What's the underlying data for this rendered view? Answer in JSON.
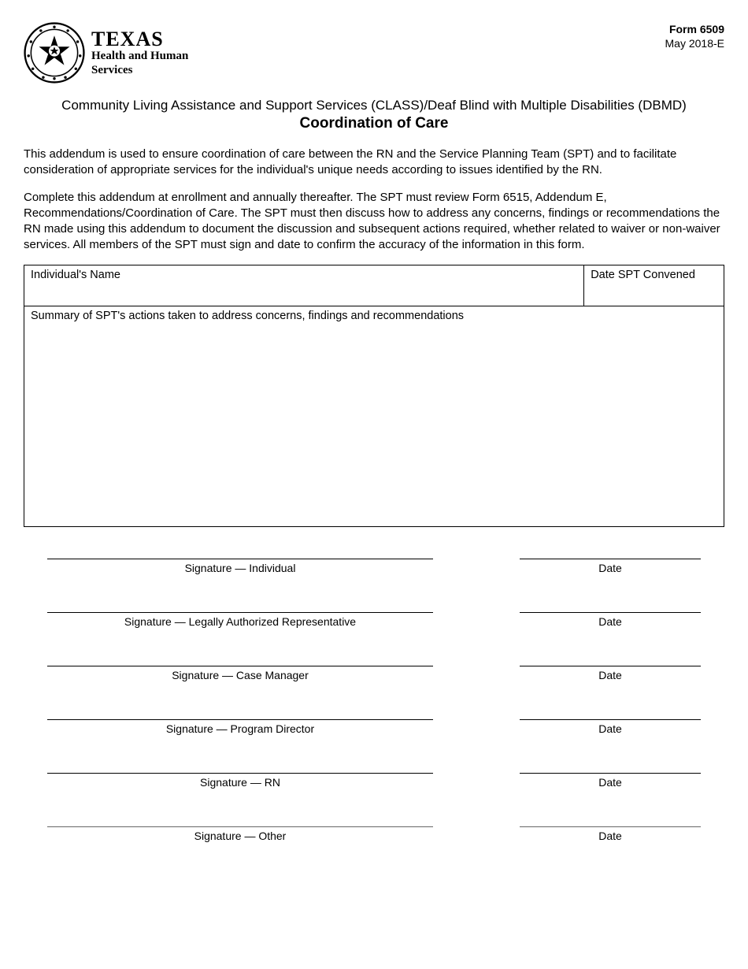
{
  "header": {
    "logo": {
      "texas": "TEXAS",
      "line2": "Health and Human",
      "line3": "Services"
    },
    "form_number": "Form 6509",
    "form_date": "May 2018-E"
  },
  "title": {
    "line1": "Community Living Assistance and Support Services (CLASS)/Deaf Blind with Multiple Disabilities (DBMD)",
    "line2": "Coordination of Care"
  },
  "paragraphs": {
    "p1": "This addendum is used to ensure coordination of care between the RN and the Service Planning Team (SPT) and to facilitate consideration of appropriate services for the individual's unique needs according to issues identified by the RN.",
    "p2": "Complete this addendum at enrollment and annually thereafter. The SPT must review Form 6515, Addendum E, Recommendations/Coordination of Care. The SPT must then discuss how to address any concerns, findings or recommendations the RN made using this addendum to document the discussion and subsequent actions required, whether related to waiver or non-waiver services. All members of the SPT must sign and date to confirm the accuracy of the information in this form."
  },
  "fields": {
    "name_label": "Individual's Name",
    "date_convened_label": "Date SPT Convened",
    "summary_label": "Summary of SPT's actions taken to address concerns, findings and recommendations"
  },
  "signatures": [
    {
      "label": "Signature — Individual",
      "date_label": "Date",
      "thin": false
    },
    {
      "label": "Signature — Legally Authorized Representative",
      "date_label": "Date",
      "thin": false
    },
    {
      "label": "Signature — Case Manager",
      "date_label": "Date",
      "thin": false
    },
    {
      "label": "Signature — Program Director",
      "date_label": "Date",
      "thin": false
    },
    {
      "label": "Signature — RN",
      "date_label": "Date",
      "thin": false
    },
    {
      "label": "Signature — Other",
      "date_label": "Date",
      "thin": true
    }
  ]
}
